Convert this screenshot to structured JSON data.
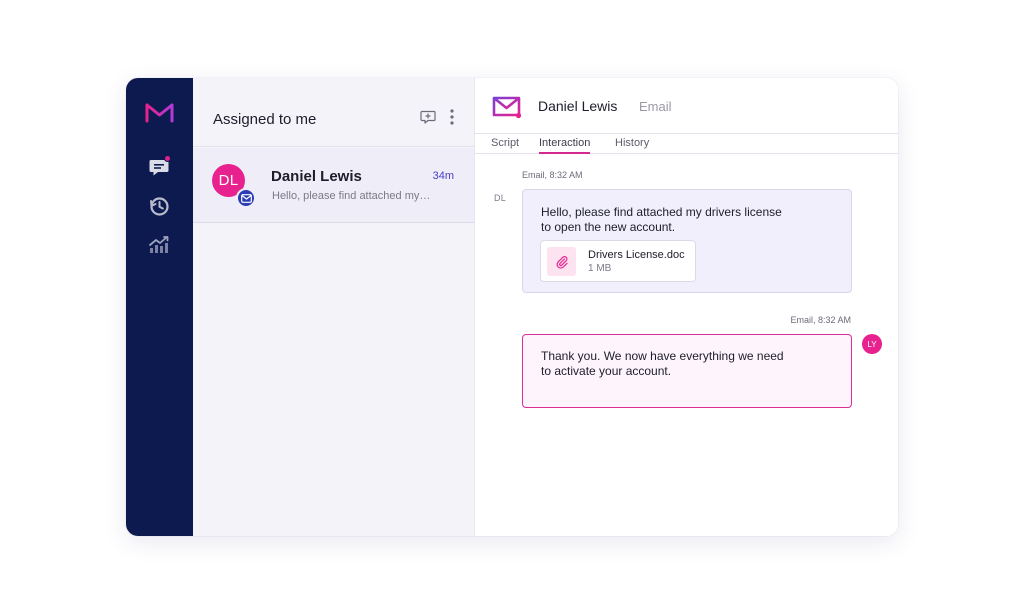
{
  "sidebar": {
    "items": [
      {
        "icon": "chat-icon",
        "has_notification": true
      },
      {
        "icon": "history-icon"
      },
      {
        "icon": "analytics-icon"
      }
    ]
  },
  "list": {
    "title": "Assigned to me",
    "conversations": [
      {
        "initials": "DL",
        "name": "Daniel Lewis",
        "time": "34m",
        "preview": "Hello, please find attached my…",
        "channel_icon": "mail-icon"
      }
    ]
  },
  "detail": {
    "name": "Daniel Lewis",
    "channel": "Email",
    "tabs": [
      "Script",
      "Interaction",
      "History"
    ],
    "active_tab": "Interaction",
    "messages": [
      {
        "direction": "incoming",
        "meta": "Email, 8:32 AM",
        "initials": "DL",
        "text": "Hello, please find attached my drivers license to open the new account.",
        "attachment": {
          "name": "Drivers License.doc",
          "size": "1 MB"
        }
      },
      {
        "direction": "outgoing",
        "meta": "Email, 8:32 AM",
        "initials": "LY",
        "text": "Thank you. We now have everything we need to activate your account."
      }
    ]
  },
  "colors": {
    "sidebar_bg": "#0d1a4f",
    "accent_pink": "#e7228e",
    "channel_blue": "#2b3cb5"
  }
}
